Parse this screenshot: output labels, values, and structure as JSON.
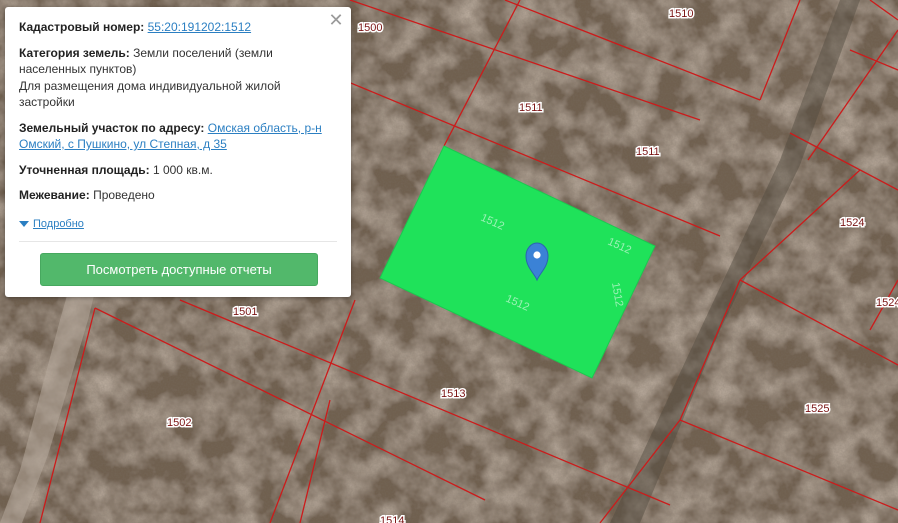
{
  "popup": {
    "cadastral_label": "Кадастровый номер:",
    "cadastral_value": "55:20:191202:1512",
    "category_label": "Категория земель:",
    "category_value": "Земли поселений (земли населенных пунктов)",
    "usage_value": "Для размещения дома индивидуальной жилой застройки",
    "address_label": "Земельный участок по адресу:",
    "address_value": "Омская область, р-н Омский, с Пушкино, ул Степная, д 35",
    "area_label": "Уточненная площадь:",
    "area_value": "1 000 кв.м.",
    "survey_label": "Межевание:",
    "survey_value": "Проведено",
    "details_link": "Подробно",
    "report_button": "Посмотреть доступные отчеты",
    "close_symbol": "✕"
  },
  "map": {
    "plot_labels": {
      "p1500": "1500",
      "p1510": "1510",
      "p1511a": "1511",
      "p1511b": "1511",
      "p1501": "1501",
      "p1502": "1502",
      "p1513": "1513",
      "p1524": "1524",
      "p1524b": "1524",
      "p1525": "1525",
      "p1514": "1514"
    },
    "selected_plot_labels": {
      "a": "1512",
      "b": "1512",
      "c": "1512",
      "d": "1512"
    },
    "colors": {
      "boundary": "#cc1b1b",
      "selected_fill": "#1fe25a",
      "marker": "#3b82d6"
    },
    "marker_icon": "map-pin-icon"
  }
}
